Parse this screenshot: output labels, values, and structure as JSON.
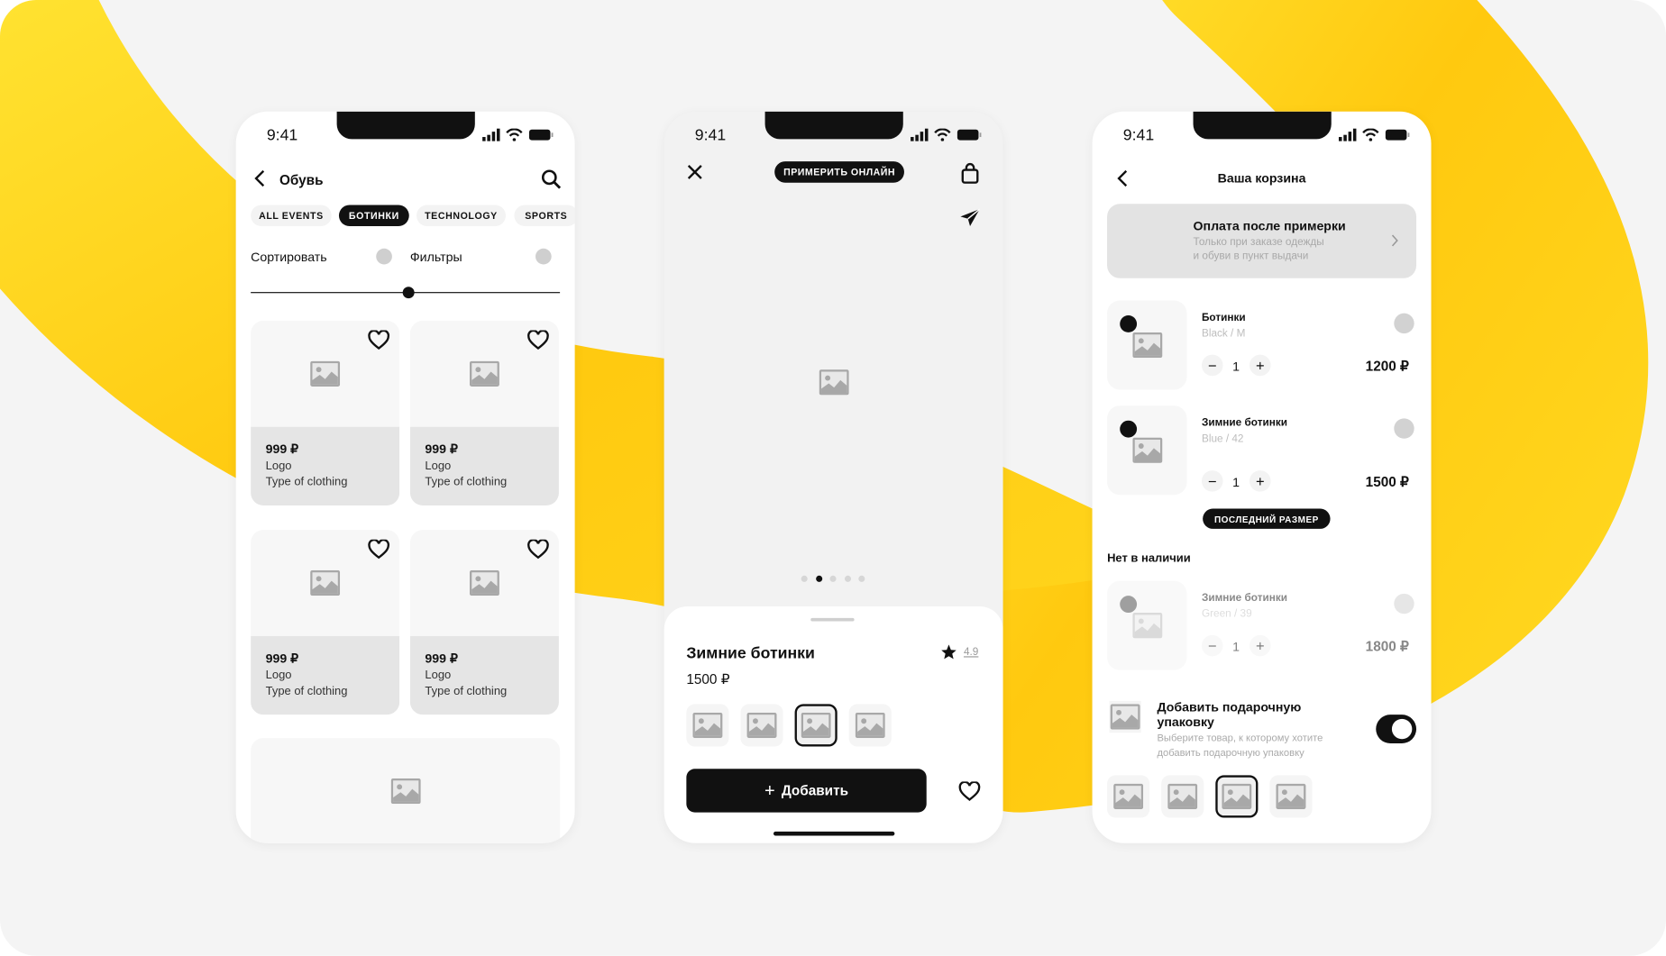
{
  "status_time": "9:41",
  "catalog": {
    "title": "Обувь",
    "chips": [
      "ALL EVENTS",
      "БОТИНКИ",
      "TECHNOLOGY",
      "SPORTS"
    ],
    "active_chip": "БОТИНКИ",
    "sort_label": "Сортировать",
    "filter_label": "Фильтры",
    "slider_value_percent": 51,
    "products": [
      {
        "price": "999 ₽",
        "brand": "Logo",
        "type": "Type of clothing"
      },
      {
        "price": "999 ₽",
        "brand": "Logo",
        "type": "Type of clothing"
      },
      {
        "price": "999 ₽",
        "brand": "Logo",
        "type": "Type of clothing"
      },
      {
        "price": "999 ₽",
        "brand": "Logo",
        "type": "Type of clothing"
      }
    ]
  },
  "product": {
    "try_on_label": "ПРИМЕРИТЬ ОНЛАЙН",
    "gallery_active_index": 2,
    "gallery_count": 5,
    "name": "Зимние ботинки",
    "rating": "4.9",
    "price": "1500 ₽",
    "selected_thumb": 3,
    "add_label": "Добавить"
  },
  "cart": {
    "title": "Ваша корзина",
    "banner": {
      "title": "Оплата после примерки",
      "line1": "Только при заказе одежды",
      "line2": "и обуви в пункт выдачи"
    },
    "items": [
      {
        "name": "Ботинки",
        "variant": "Black / M",
        "qty": "1",
        "price": "1200 ₽"
      },
      {
        "name": "Зимние ботинки",
        "variant": "Blue / 42",
        "qty": "1",
        "price": "1500 ₽"
      }
    ],
    "last_size_badge": "ПОСЛЕДНИЙ РАЗМЕР",
    "out_of_stock_title": "Нет в наличии",
    "out_of_stock": {
      "name": "Зимние ботинки",
      "variant": "Green / 39",
      "qty": "1",
      "price": "1800 ₽"
    },
    "gift": {
      "title_line1": "Добавить подарочную",
      "title_line2": "упаковку",
      "desc_line1": "Выберите товар, к которому хотите",
      "desc_line2": "добавить подарочную упаковку",
      "enabled": true
    },
    "selected_gift_thumb": 3
  },
  "colors": {
    "accent_yellow": "#FFD21A",
    "dark": "#111111",
    "background": "#F4F4F4"
  }
}
